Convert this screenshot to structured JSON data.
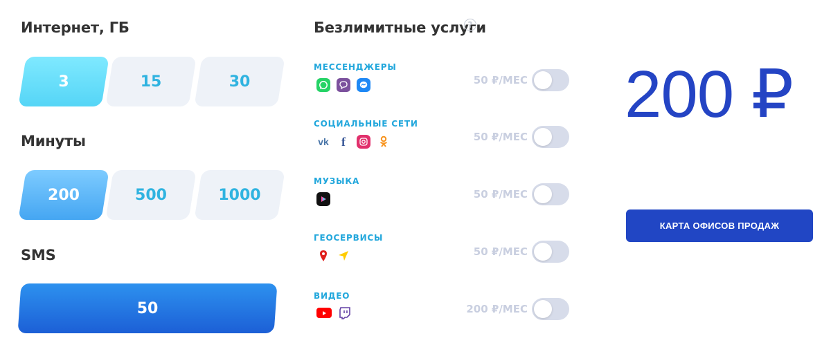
{
  "internet": {
    "heading": "Интернет, ГБ",
    "options": [
      "3",
      "15",
      "30"
    ],
    "selected": "3"
  },
  "minutes": {
    "heading": "Минуты",
    "options": [
      "200",
      "500",
      "1000"
    ],
    "selected": "200"
  },
  "sms": {
    "heading": "SMS",
    "value": "50"
  },
  "unlimited": {
    "heading": "Безлимитные услуги",
    "help_icon": "?",
    "services": [
      {
        "name": "МЕССЕНДЖЕРЫ",
        "price": "50 ₽/МЕС",
        "enabled": false,
        "icons": [
          "whatsapp-icon",
          "viber-icon",
          "messenger-icon"
        ]
      },
      {
        "name": "СОЦИАЛЬНЫЕ СЕТИ",
        "price": "50 ₽/МЕС",
        "enabled": false,
        "icons": [
          "vk-icon",
          "facebook-icon",
          "instagram-icon",
          "odnoklassniki-icon"
        ]
      },
      {
        "name": "МУЗЫКА",
        "price": "50 ₽/МЕС",
        "enabled": false,
        "icons": [
          "music-app-icon"
        ]
      },
      {
        "name": "ГЕОСЕРВИСЫ",
        "price": "50 ₽/МЕС",
        "enabled": false,
        "icons": [
          "map-pin-icon",
          "navigator-icon"
        ]
      },
      {
        "name": "ВИДЕО",
        "price": "200 ₽/МЕС",
        "enabled": false,
        "icons": [
          "youtube-icon",
          "twitch-icon"
        ]
      }
    ]
  },
  "total": {
    "price": "200 ₽"
  },
  "offices_button": {
    "label": "КАРТА ОФИСОВ ПРОДАЖ"
  },
  "colors": {
    "accent_blue": "#2146c4",
    "service_label": "#22a7dc",
    "toggle_off": "#d7dcea"
  }
}
